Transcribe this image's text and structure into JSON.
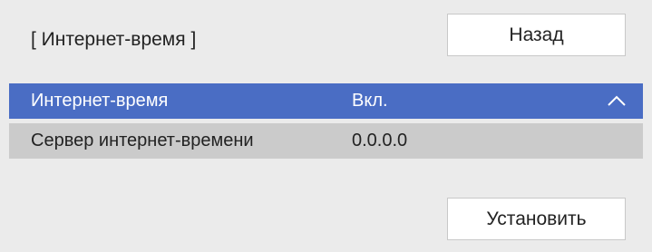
{
  "header": {
    "title": "[ Интернет-время ]",
    "back_label": "Назад"
  },
  "rows": [
    {
      "label": "Интернет-время",
      "value": "Вкл.",
      "selected": true,
      "icon": "chevron-up-icon"
    },
    {
      "label": "Сервер интернет-времени",
      "value": "0.0.0.0",
      "selected": false
    }
  ],
  "footer": {
    "set_label": "Установить"
  },
  "colors": {
    "background": "#ebebeb",
    "selected_row": "#4a6dc4",
    "row_gray": "#cbcbcb",
    "button_bg": "#ffffff"
  }
}
